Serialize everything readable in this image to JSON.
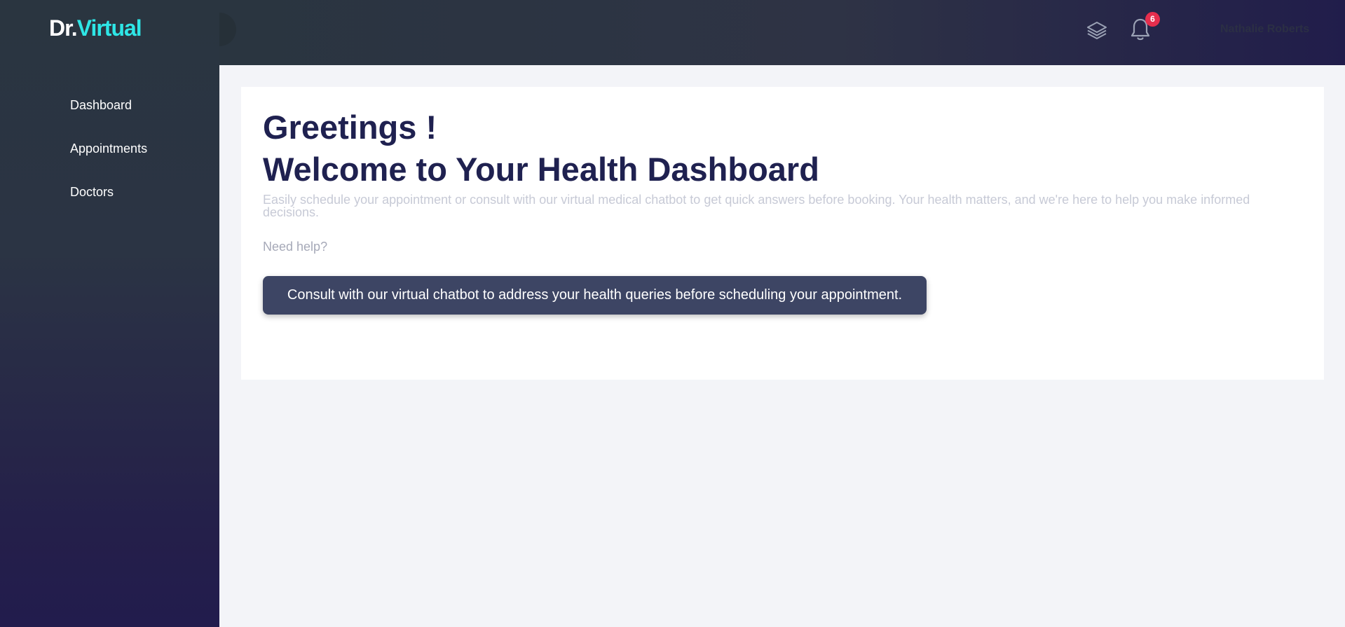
{
  "brand": {
    "prefix": "Dr.",
    "name": "Virtual"
  },
  "sidebar": {
    "items": [
      {
        "label": "Dashboard"
      },
      {
        "label": "Appointments"
      },
      {
        "label": "Doctors"
      }
    ]
  },
  "header": {
    "notification_count": "6",
    "user_name": "Nathalie Roberts",
    "icons": [
      "layers-icon",
      "bell-icon"
    ]
  },
  "main": {
    "greeting": "Greetings !",
    "title": "Welcome to Your Health Dashboard",
    "description": "Easily schedule your appointment or consult with our virtual medical chatbot to get quick answers before booking. Your health matters, and we're here to help you make informed decisions.",
    "help_label": "Need help?",
    "consult_button": "Consult with our virtual chatbot to address your health queries before scheduling your appointment."
  },
  "colors": {
    "accent": "#2ee6e6",
    "heading": "#1f2150",
    "button": "#3d4564",
    "badge": "#e52e4d"
  }
}
